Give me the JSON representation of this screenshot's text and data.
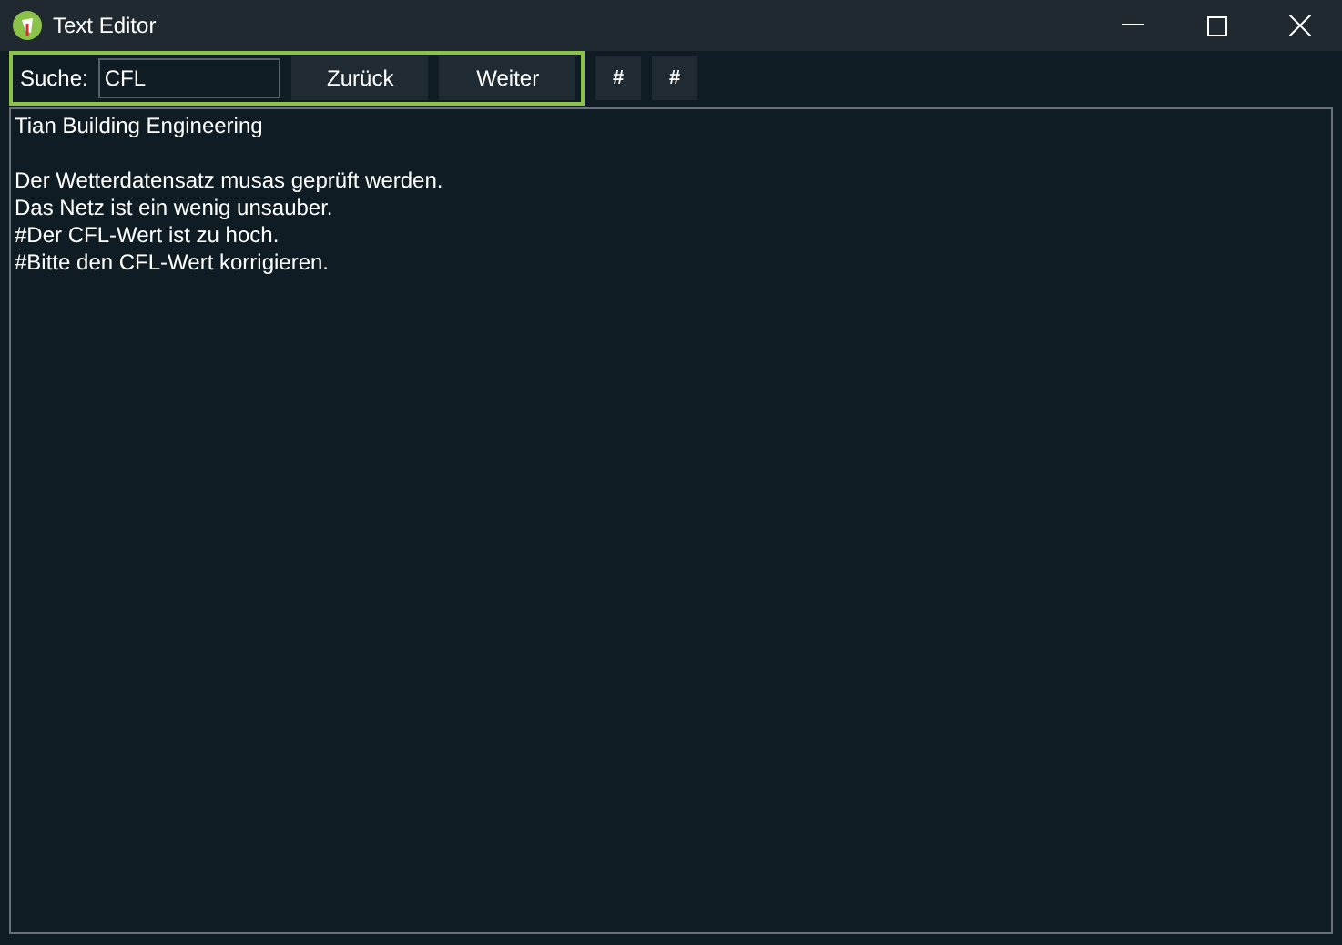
{
  "window": {
    "title": "Text Editor"
  },
  "search": {
    "label": "Suche:",
    "value": "CFL",
    "focused": true
  },
  "buttons": [
    {
      "label": "Zurück",
      "kind": "nav"
    },
    {
      "label": "Weiter",
      "kind": "nav"
    },
    {
      "label": "#",
      "kind": "tool"
    },
    {
      "label": "#",
      "kind": "tool"
    }
  ],
  "editor": {
    "paragraphs": [
      {
        "lines": [
          "Tian Building Engineering"
        ]
      },
      {
        "lines": [
          "Der Wetterdatensatz musas geprüft werden.",
          "Das Netz ist ein wenig unsauber.",
          "#Der CFL-Wert ist zu hoch.",
          "#Bitte den CFL-Wert korrigieren."
        ]
      }
    ]
  }
}
